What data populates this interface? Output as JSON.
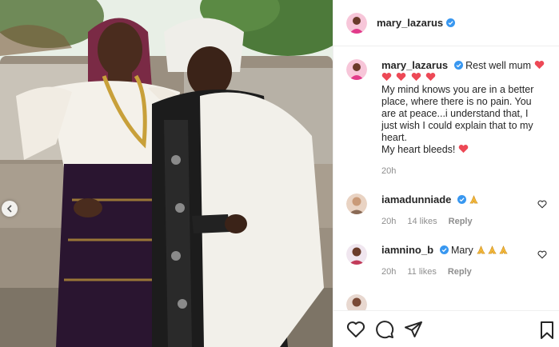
{
  "post": {
    "author": "mary_lazarus",
    "verified": true,
    "caption": {
      "first_line": "Rest well mum",
      "lines": [
        "My mind knows you are in a better",
        "place, where there is no pain. You",
        "are at peace...i understand that, I",
        "just wish I could explain that to my",
        "heart.",
        "My heart bleeds!"
      ]
    },
    "time": "20h"
  },
  "comments": [
    {
      "user": "iamadunniade",
      "verified": true,
      "text": "",
      "emoji": "pray",
      "time": "20h",
      "likes": "14 likes",
      "reply": "Reply"
    },
    {
      "user": "iamnino_b",
      "verified": true,
      "text": "Mary",
      "emoji": "pray x3",
      "time": "20h",
      "likes": "11 likes",
      "reply": "Reply"
    },
    {
      "user": "",
      "verified": true,
      "text": "",
      "time": "",
      "likes": "",
      "reply": ""
    }
  ],
  "icons": {
    "like": "heart-icon",
    "comment": "comment-icon",
    "share": "paper-plane-icon",
    "save": "bookmark-icon",
    "carousel_prev": "chevron-left-icon"
  },
  "colors": {
    "verified": "#3897f0",
    "heart": "#ed4956",
    "muted": "#8e8e8e",
    "text": "#262626"
  }
}
